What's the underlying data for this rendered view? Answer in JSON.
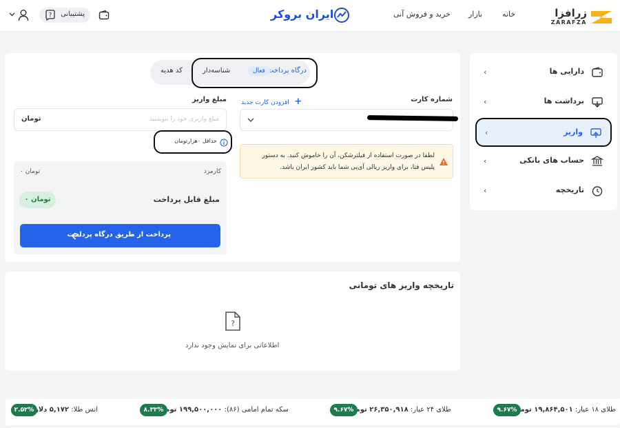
{
  "header": {
    "logo_fa": "زرافزا",
    "logo_en": "ZARAFZA",
    "nav": [
      "خانه",
      "بازار",
      "خرید و فروش آنی"
    ],
    "brand": "ایران بروکر",
    "support": "پشتیبانی"
  },
  "sidebar": {
    "items": [
      {
        "label": "دارایی ها",
        "icon": "wallet-icon"
      },
      {
        "label": "برداشت ها",
        "icon": "withdraw-icon"
      },
      {
        "label": "واریز",
        "icon": "deposit-icon"
      },
      {
        "label": "حساب های بانکی",
        "icon": "bank-icon"
      },
      {
        "label": "تاریخچه",
        "icon": "history-icon"
      }
    ]
  },
  "deposit": {
    "tabs": {
      "gateway": "درگاه پرداخت",
      "active_badge": "فعال",
      "id_deposit": "شناسه‌دار",
      "gift_code": "کد هدیه"
    },
    "card_number_label": "شماره کارت",
    "add_card": "افزودن کارت جدید",
    "amount_label": "مبلغ واریز",
    "amount_placeholder": "مبلغ واریزی خود را بنویسید",
    "amount_unit": "تومان",
    "minimum": "حداقل ۰هزارتومان",
    "warning": "لطفا در صورت استفاده از فیلترشکن، آن را خاموش کنید. به دستور پلیس فتا، برای واریز ریالی آی‌پی شما باید کشور ایران باشد.",
    "fee_label": "کارمزد",
    "fee_value": "۰ تومان",
    "payable_label": "مبلغ قابل پرداخت",
    "payable_value": "۰ تومان",
    "pay_button": "پرداخت از طریق درگاه پرداخت"
  },
  "history": {
    "title": "تاریخچه واریز های تومانی",
    "empty": "اطلاعاتی برای نمایش وجود ندارد"
  },
  "ticker": [
    {
      "label": "طلای ۱۸ عیار:",
      "value": "۱۹,۸۶۴,۵۰۱ تومان",
      "change": "۹.۶۷%"
    },
    {
      "label": "طلای ۲۴ عیار:",
      "value": "۲۶,۳۵۰,۹۱۸ تومان",
      "change": "۹.۶۷%"
    },
    {
      "label": "سکه تمام امامی (۸۶):",
      "value": "۱۹۹,۵۰۰,۰۰۰ تومان",
      "change": "۸.۳۳%"
    },
    {
      "label": "انس طلا:",
      "value": "۵,۱۷۲ دلار",
      "change": "۲.۵۲%"
    }
  ],
  "colors": {
    "primary": "#2563eb",
    "success": "#1f7a4c",
    "warning_bg": "#fff7e6"
  }
}
